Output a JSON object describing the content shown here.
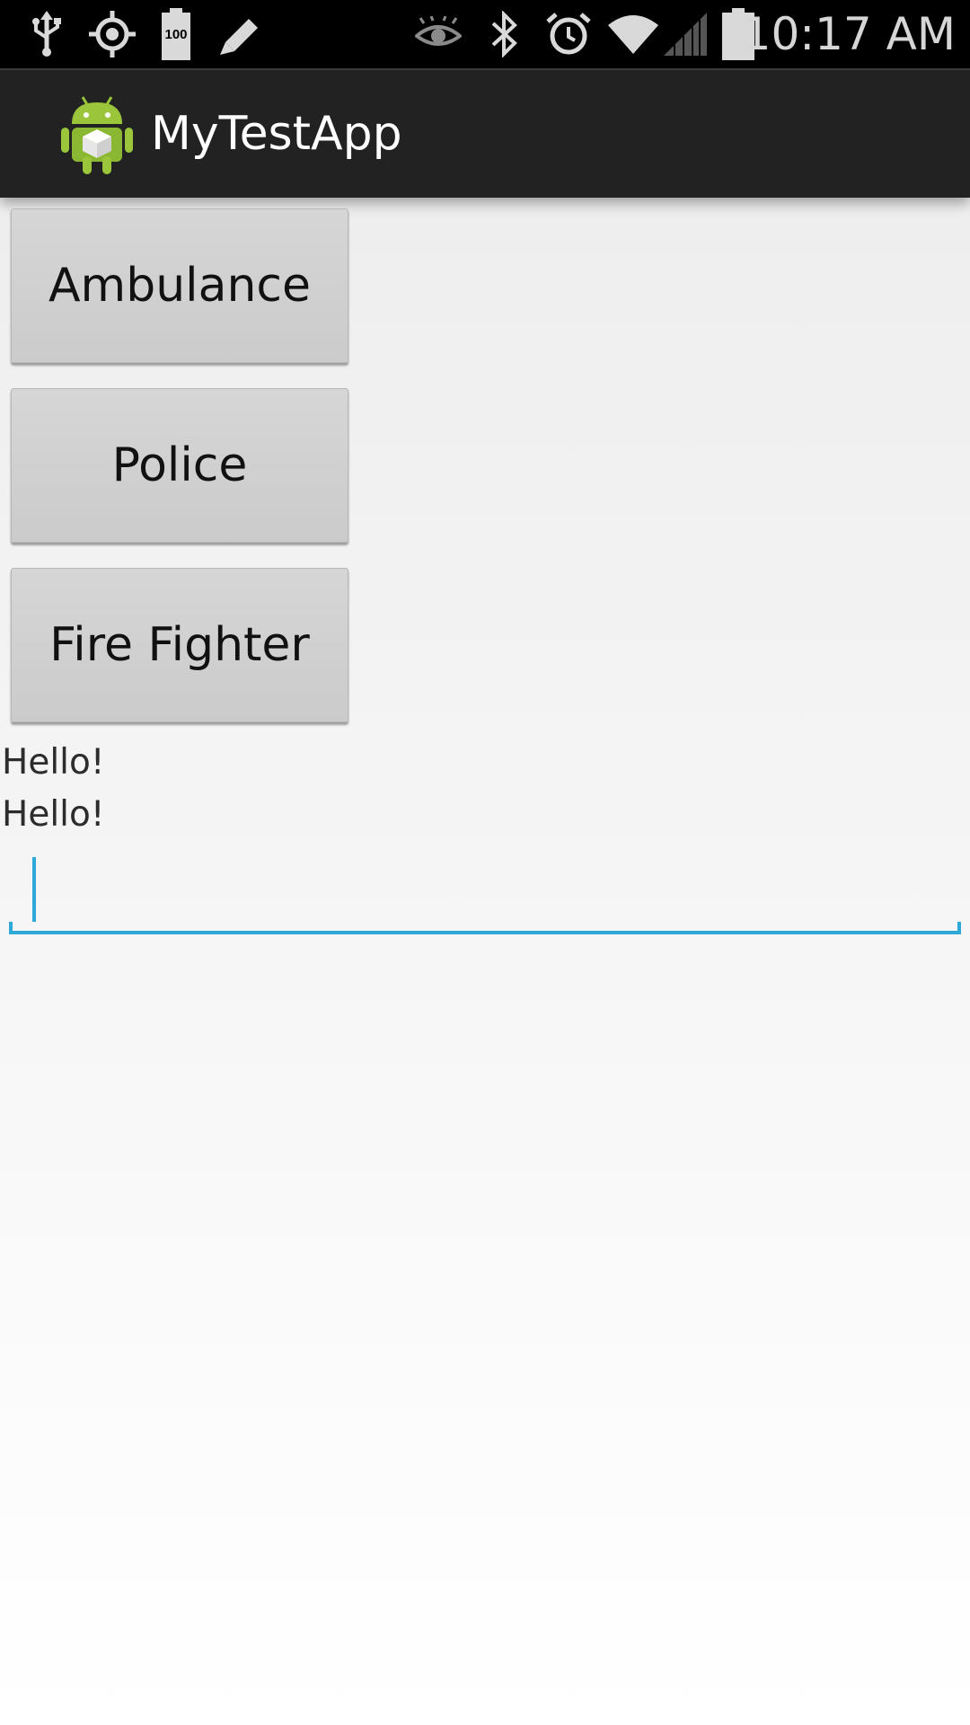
{
  "status_bar": {
    "time": "10:17 AM",
    "battery_label": "100",
    "icons": [
      "usb-icon",
      "gps-icon",
      "battery-100-icon",
      "edit-icon",
      "eye-icon",
      "bluetooth-icon",
      "alarm-icon",
      "wifi-icon",
      "signal-icon",
      "battery-icon"
    ]
  },
  "action_bar": {
    "title": "MyTestApp",
    "icon": "android-app-icon"
  },
  "buttons": {
    "ambulance": "Ambulance",
    "police": "Police",
    "fire_fighter": "Fire Fighter"
  },
  "messages": [
    "Hello!",
    "Hello!"
  ],
  "input": {
    "value": "",
    "placeholder": ""
  },
  "colors": {
    "status_bar": "#000000",
    "action_bar": "#222222",
    "accent": "#2ea8d6",
    "button": "#d0d0d0"
  }
}
